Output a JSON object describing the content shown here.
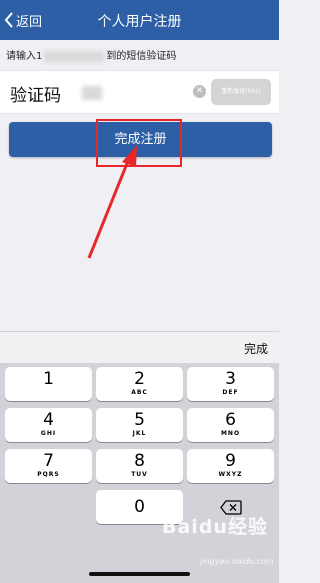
{
  "nav": {
    "back_label": "返回",
    "title": "个人用户注册"
  },
  "hint": {
    "prefix": "请输入1",
    "suffix": "到的短信验证码"
  },
  "code_field": {
    "label": "验证码",
    "resend_label": "重新发送(05s)"
  },
  "submit": {
    "label": "完成注册"
  },
  "toolbar": {
    "done_label": "完成"
  },
  "keyboard": {
    "keys": [
      {
        "num": "1",
        "letters": ""
      },
      {
        "num": "2",
        "letters": "ABC"
      },
      {
        "num": "3",
        "letters": "DEF"
      },
      {
        "num": "4",
        "letters": "GHI"
      },
      {
        "num": "5",
        "letters": "JKL"
      },
      {
        "num": "6",
        "letters": "MNO"
      },
      {
        "num": "7",
        "letters": "PQRS"
      },
      {
        "num": "8",
        "letters": "TUV"
      },
      {
        "num": "9",
        "letters": "WXYZ"
      },
      {
        "num": "0",
        "letters": ""
      }
    ]
  },
  "watermark": {
    "brand": "Baidu经验",
    "url": "jingyan.baidu.com"
  },
  "colors": {
    "brand": "#2d5fa6",
    "highlight": "#e8272b",
    "keyboard_bg": "#d1d3d9"
  }
}
